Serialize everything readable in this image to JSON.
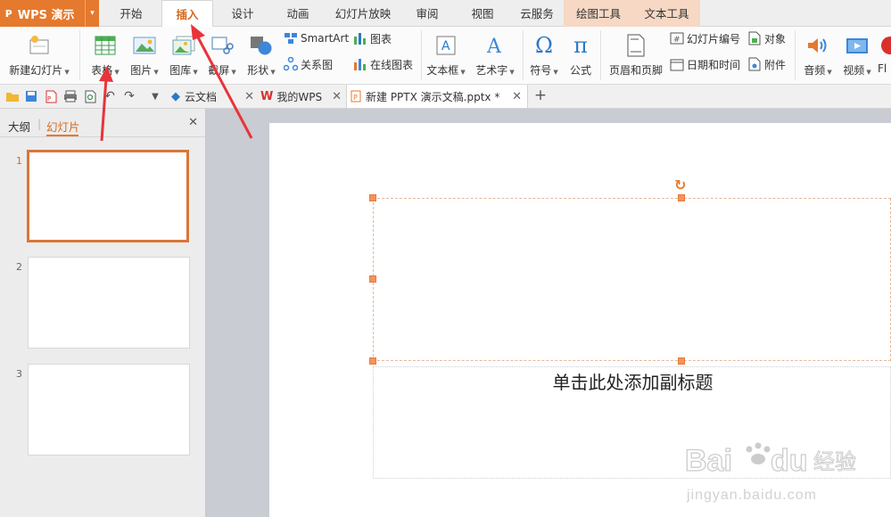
{
  "app": {
    "name": "WPS 演示"
  },
  "menu_tabs": [
    "开始",
    "插入",
    "设计",
    "动画",
    "幻灯片放映",
    "审阅",
    "视图",
    "云服务",
    "绘图工具",
    "文本工具"
  ],
  "active_tab": "插入",
  "ribbon": {
    "new_slide": "新建幻灯片",
    "table": "表格",
    "picture": "图片",
    "gallery": "图库",
    "screenshot": "截屏",
    "shape": "形状",
    "smartart": "SmartArt",
    "chart": "图表",
    "relation": "关系图",
    "online_chart": "在线图表",
    "textbox": "文本框",
    "wordart": "艺术字",
    "symbol": "符号",
    "formula": "公式",
    "header_footer": "页眉和页脚",
    "slide_number": "幻灯片编号",
    "date_time": "日期和时间",
    "object": "对象",
    "attachment": "附件",
    "audio": "音频",
    "video": "视频",
    "flash": "Fl"
  },
  "doc_tabs": [
    {
      "label": "云文档"
    },
    {
      "label": "我的WPS"
    },
    {
      "label": "新建 PPTX 演示文稿.pptx *"
    }
  ],
  "panel": {
    "outline_tab": "大纲",
    "slides_tab": "幻灯片",
    "slide_numbers": [
      "1",
      "2",
      "3"
    ]
  },
  "slide": {
    "subtitle_placeholder": "单击此处添加副标题"
  },
  "watermark": {
    "brand": "Baidu经验",
    "url": "jingyan.baidu.com"
  },
  "colors": {
    "accent": "#e5792d",
    "arrow": "#e8333a",
    "selection": "#f3945a"
  }
}
